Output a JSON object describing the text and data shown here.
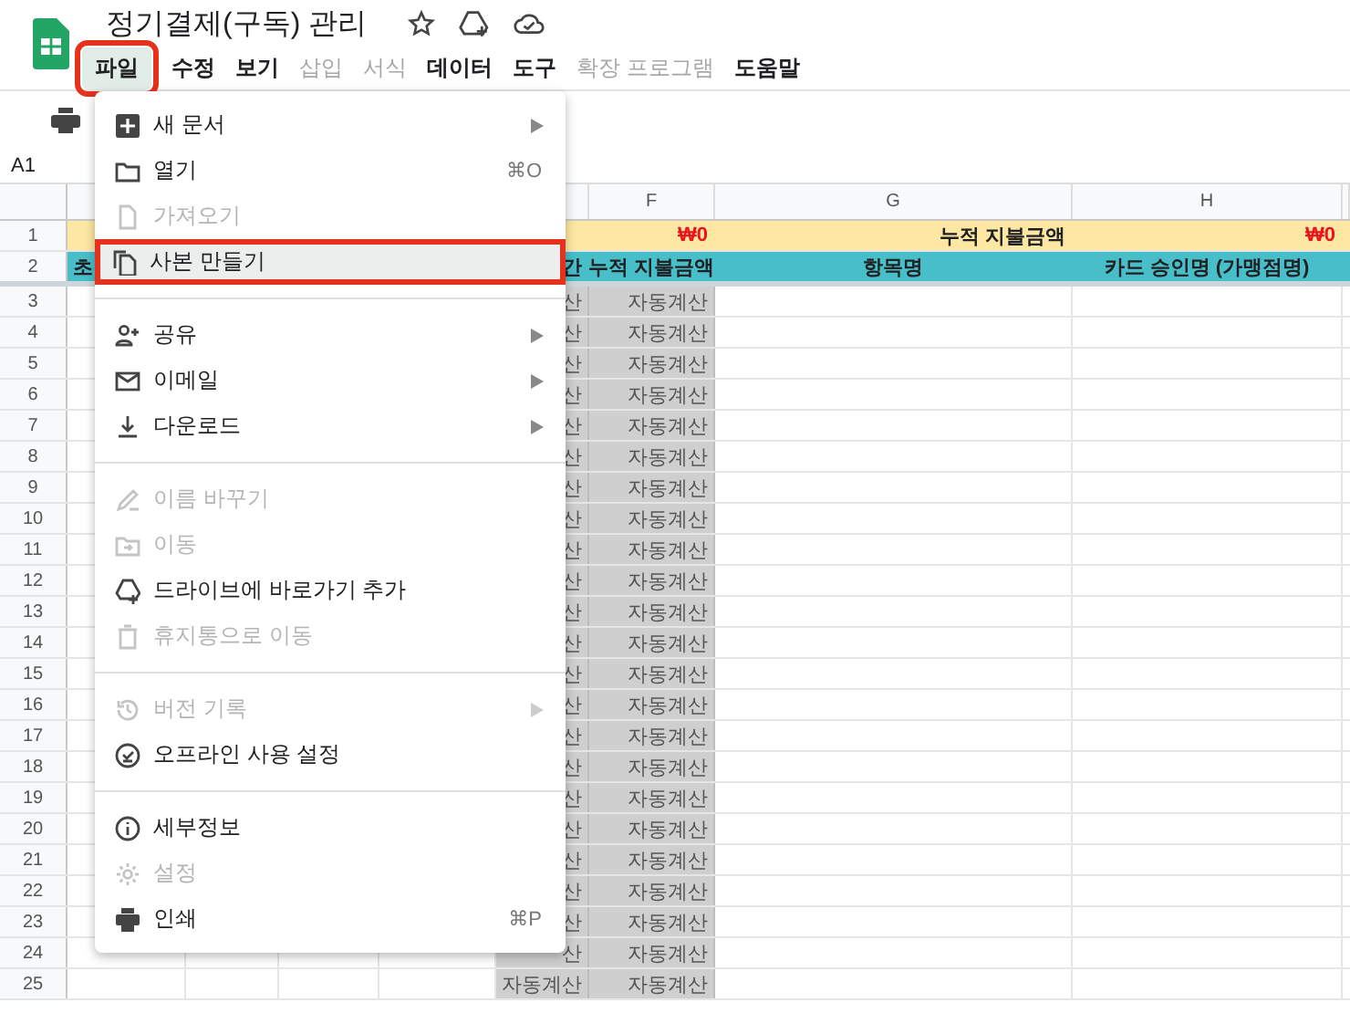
{
  "app": {
    "title": "정기결제(구독) 관리"
  },
  "menu_bar": [
    {
      "label": "파일",
      "selected": true,
      "disabled": false
    },
    {
      "label": "수정",
      "selected": false,
      "disabled": false
    },
    {
      "label": "보기",
      "selected": false,
      "disabled": false
    },
    {
      "label": "삽입",
      "selected": false,
      "disabled": true
    },
    {
      "label": "서식",
      "selected": false,
      "disabled": true
    },
    {
      "label": "데이터",
      "selected": false,
      "disabled": false
    },
    {
      "label": "도구",
      "selected": false,
      "disabled": false
    },
    {
      "label": "확장 프로그램",
      "selected": false,
      "disabled": true
    },
    {
      "label": "도움말",
      "selected": false,
      "disabled": false
    }
  ],
  "name_box": "A1",
  "column_headers": {
    "f": "F",
    "g": "G",
    "h": "H"
  },
  "rows": [
    {
      "kind": "total",
      "num": "1",
      "cells": {
        "f": "₩0",
        "g": "누적 지불금액",
        "h": "₩0"
      }
    },
    {
      "kind": "header",
      "num": "2",
      "cells": {
        "a": "초",
        "e": "간",
        "f": "누적 지불금액",
        "g": "항목명",
        "h": "카드 승인명 (가맹점명)"
      }
    },
    {
      "kind": "data",
      "num": "3",
      "cells": {
        "e": "산",
        "f": "자동계산"
      }
    },
    {
      "kind": "data",
      "num": "4",
      "cells": {
        "e": "산",
        "f": "자동계산"
      }
    },
    {
      "kind": "data",
      "num": "5",
      "cells": {
        "e": "산",
        "f": "자동계산"
      }
    },
    {
      "kind": "data",
      "num": "6",
      "cells": {
        "e": "산",
        "f": "자동계산"
      }
    },
    {
      "kind": "data",
      "num": "7",
      "cells": {
        "e": "산",
        "f": "자동계산"
      }
    },
    {
      "kind": "data",
      "num": "8",
      "cells": {
        "e": "산",
        "f": "자동계산"
      }
    },
    {
      "kind": "data",
      "num": "9",
      "cells": {
        "e": "산",
        "f": "자동계산"
      }
    },
    {
      "kind": "data",
      "num": "10",
      "cells": {
        "e": "산",
        "f": "자동계산"
      }
    },
    {
      "kind": "data",
      "num": "11",
      "cells": {
        "e": "산",
        "f": "자동계산"
      }
    },
    {
      "kind": "data",
      "num": "12",
      "cells": {
        "e": "산",
        "f": "자동계산"
      }
    },
    {
      "kind": "data",
      "num": "13",
      "cells": {
        "e": "산",
        "f": "자동계산"
      }
    },
    {
      "kind": "data",
      "num": "14",
      "cells": {
        "e": "산",
        "f": "자동계산"
      }
    },
    {
      "kind": "data",
      "num": "15",
      "cells": {
        "e": "산",
        "f": "자동계산"
      }
    },
    {
      "kind": "data",
      "num": "16",
      "cells": {
        "e": "산",
        "f": "자동계산"
      }
    },
    {
      "kind": "data",
      "num": "17",
      "cells": {
        "e": "산",
        "f": "자동계산"
      }
    },
    {
      "kind": "data",
      "num": "18",
      "cells": {
        "e": "산",
        "f": "자동계산"
      }
    },
    {
      "kind": "data",
      "num": "19",
      "cells": {
        "e": "산",
        "f": "자동계산"
      }
    },
    {
      "kind": "data",
      "num": "20",
      "cells": {
        "e": "산",
        "f": "자동계산"
      }
    },
    {
      "kind": "data",
      "num": "21",
      "cells": {
        "e": "산",
        "f": "자동계산"
      }
    },
    {
      "kind": "data",
      "num": "22",
      "cells": {
        "e": "산",
        "f": "자동계산"
      }
    },
    {
      "kind": "data",
      "num": "23",
      "cells": {
        "e": "산",
        "f": "자동계산"
      }
    },
    {
      "kind": "data",
      "num": "24",
      "cells": {
        "e": "산",
        "f": "자동계산"
      }
    },
    {
      "kind": "data",
      "num": "25",
      "cells": {
        "e": "자동계산",
        "f": "자동계산"
      }
    }
  ],
  "file_menu": {
    "groups": [
      [
        {
          "label": "새 문서",
          "submenu": true,
          "disabled": false,
          "highlighted": false
        },
        {
          "label": "열기",
          "shortcut": "⌘O",
          "submenu": false,
          "disabled": false,
          "highlighted": false
        },
        {
          "label": "가져오기",
          "submenu": false,
          "disabled": true,
          "highlighted": false
        },
        {
          "label": "사본 만들기",
          "submenu": false,
          "disabled": false,
          "highlighted": true
        }
      ],
      [
        {
          "label": "공유",
          "submenu": true,
          "disabled": false,
          "highlighted": false
        },
        {
          "label": "이메일",
          "submenu": true,
          "disabled": false,
          "highlighted": false
        },
        {
          "label": "다운로드",
          "submenu": true,
          "disabled": false,
          "highlighted": false
        }
      ],
      [
        {
          "label": "이름 바꾸기",
          "submenu": false,
          "disabled": true,
          "highlighted": false
        },
        {
          "label": "이동",
          "submenu": false,
          "disabled": true,
          "highlighted": false
        },
        {
          "label": "드라이브에 바로가기 추가",
          "submenu": false,
          "disabled": false,
          "highlighted": false
        },
        {
          "label": "휴지통으로 이동",
          "submenu": false,
          "disabled": true,
          "highlighted": false
        }
      ],
      [
        {
          "label": "버전 기록",
          "submenu": true,
          "disabled": true,
          "highlighted": false
        },
        {
          "label": "오프라인 사용 설정",
          "submenu": false,
          "disabled": false,
          "highlighted": false
        }
      ],
      [
        {
          "label": "세부정보",
          "submenu": false,
          "disabled": false,
          "highlighted": false
        },
        {
          "label": "설정",
          "submenu": false,
          "disabled": true,
          "highlighted": false
        },
        {
          "label": "인쇄",
          "shortcut": "⌘P",
          "submenu": false,
          "disabled": false,
          "highlighted": false
        }
      ]
    ]
  }
}
